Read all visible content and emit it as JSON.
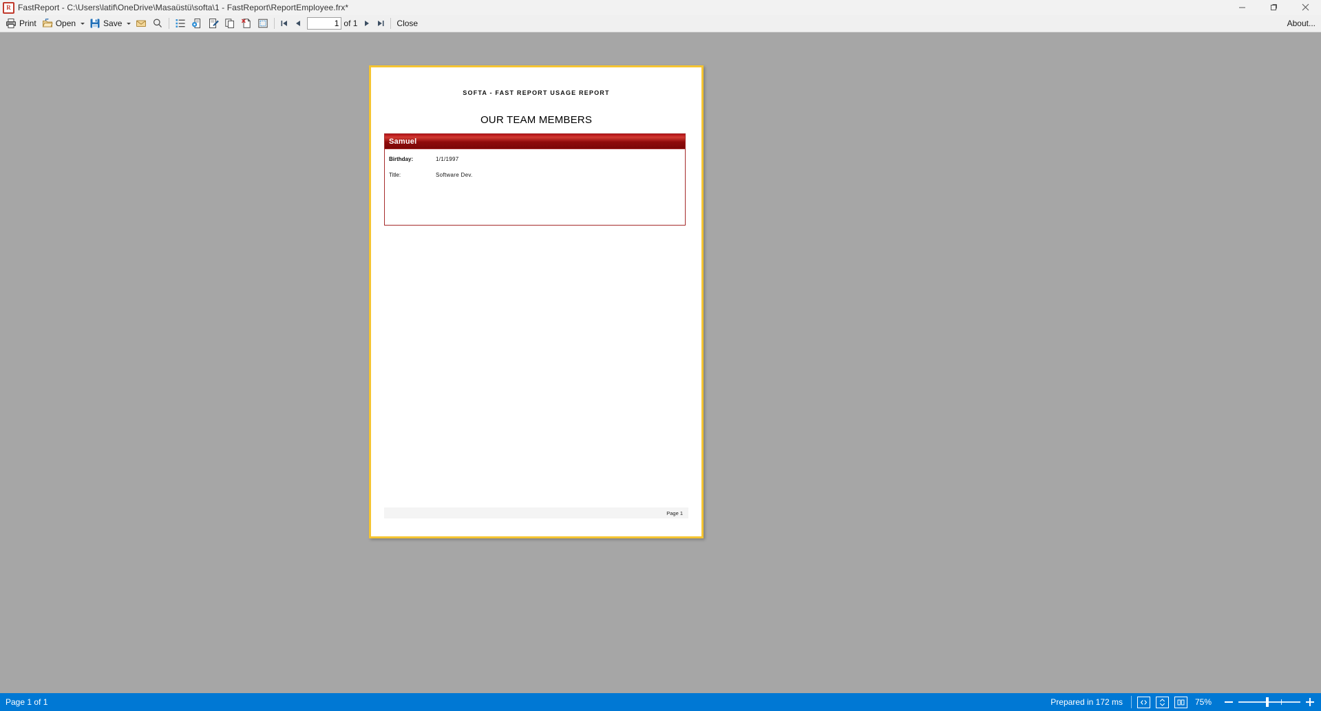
{
  "window": {
    "title": "FastReport - C:\\Users\\latif\\OneDrive\\Masaüstü\\softa\\1 - FastReport\\ReportEmployee.frx*",
    "app_icon": "fastreport-icon",
    "minimize_label": "minimize-icon",
    "maximize_label": "maximize-icon",
    "close_label": "close-icon"
  },
  "toolbar": {
    "print_label": "Print",
    "open_label": "Open",
    "save_label": "Save",
    "email_icon": "email-icon",
    "find_icon": "find-icon",
    "outline_icon": "outline-icon",
    "page_setup_icon": "page-setup-icon",
    "edit_page_icon": "edit-page-icon",
    "copy_page_icon": "copy-page-icon",
    "delete_page_icon": "delete-page-icon",
    "select_icon": "select-icon",
    "first_page_icon": "first-page-icon",
    "prev_page_icon": "prev-page-icon",
    "next_page_icon": "next-page-icon",
    "last_page_icon": "last-page-icon",
    "page_number_value": "1",
    "page_number_placeholder": "1",
    "page_of_label": "of 1",
    "close_label": "Close",
    "about_label": "About..."
  },
  "report": {
    "header_title": "SOFTA - FAST REPORT USAGE REPORT",
    "subtitle": "OUR TEAM MEMBERS",
    "card": {
      "name": "Samuel",
      "fields": [
        {
          "label": "Birthday:",
          "value": "1/1/1997",
          "bold": true
        },
        {
          "label": "Title:",
          "value": "Software Dev.",
          "bold": false
        }
      ]
    },
    "footer_text": "Page 1"
  },
  "statusbar": {
    "page_status": "Page 1 of 1",
    "prepared_text": "Prepared in 172 ms",
    "fit_width_icon": "fit-width-icon",
    "fit_page_icon": "fit-page-icon",
    "two_page_icon": "two-page-icon",
    "zoom_percent": "75%",
    "zoom_out_icon": "zoom-out-icon",
    "zoom_in_icon": "zoom-in-icon"
  },
  "colors": {
    "accent": "#0078d4",
    "page_border": "#f5c431",
    "card_red": "#a52a2a",
    "canvas_gray": "#a6a6a6"
  }
}
